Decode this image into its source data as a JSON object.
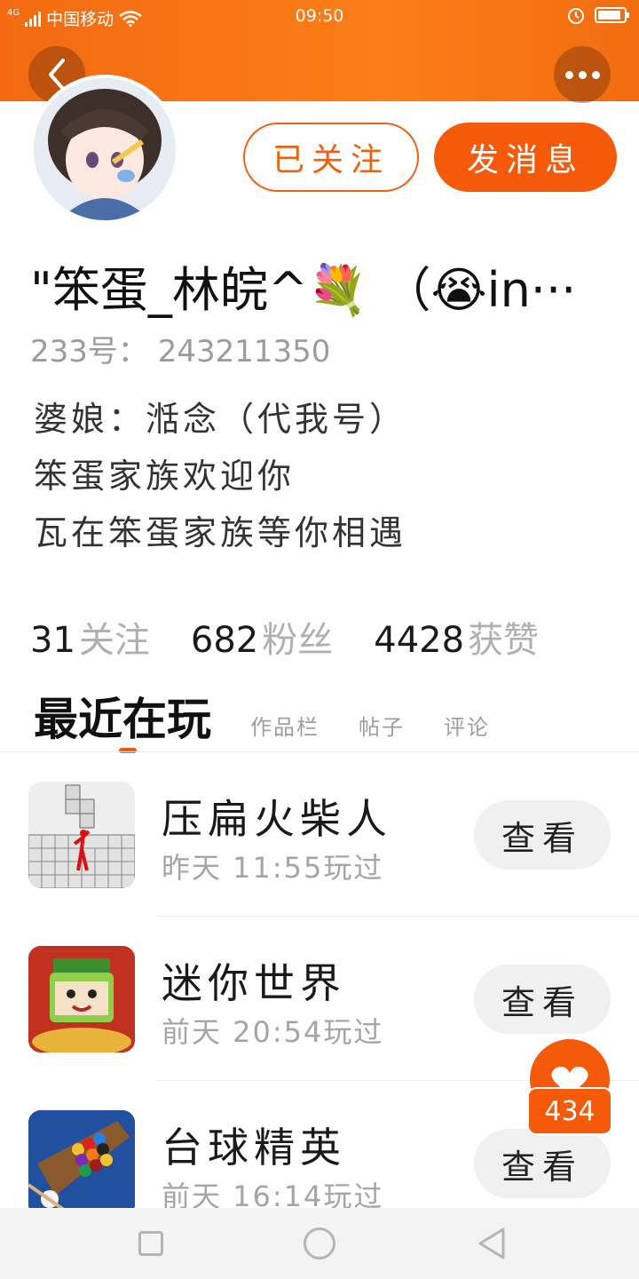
{
  "status_bar": {
    "network": "4G",
    "carrier": "中国移动",
    "time": "09:50",
    "icons": [
      "signal-icon",
      "wifi-icon",
      "alarm-icon",
      "battery-icon"
    ],
    "battery_level": 0.9
  },
  "header": {
    "back_icon": "back-arrow-icon",
    "more_icon": "more-dots-icon"
  },
  "profile": {
    "follow_label": "已关注",
    "message_label": "发消息",
    "nickname": "\"笨蛋_林皖^💐 （😭in···",
    "uid": "233号： 243211350",
    "bio": [
      "婆娘：湉念（代我号）",
      "笨蛋家族欢迎你",
      "瓦在笨蛋家族等你相遇"
    ]
  },
  "stats": [
    {
      "value": "31",
      "label": "关注"
    },
    {
      "value": "682",
      "label": "粉丝"
    },
    {
      "value": "4428",
      "label": "获赞"
    }
  ],
  "tabs": {
    "active": "最近在玩",
    "others": [
      "作品栏",
      "帖子",
      "评论"
    ]
  },
  "games": [
    {
      "name": "压扁火柴人",
      "played": "昨天 11:55玩过",
      "view_label": "查看"
    },
    {
      "name": "迷你世界",
      "played": "前天 20:54玩过",
      "view_label": "查看"
    },
    {
      "name": "台球精英",
      "played": "前天 16:14玩过",
      "view_label": "查看"
    }
  ],
  "like": {
    "count": "434",
    "icon": "heart-icon"
  },
  "nav": {
    "icons": [
      "recent-apps-icon",
      "home-icon",
      "back-icon"
    ]
  },
  "colors": {
    "accent": "#f55a0a",
    "header_start": "#f36a12",
    "header_end": "#fb7e17"
  }
}
